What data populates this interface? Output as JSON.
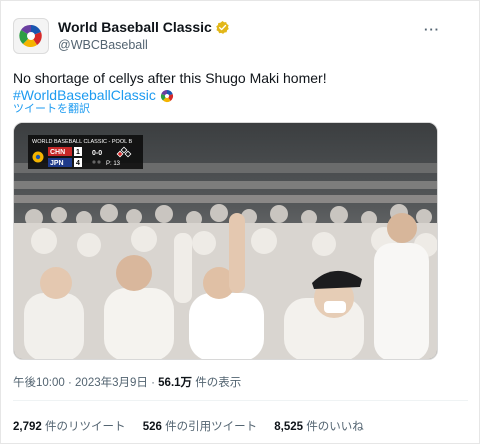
{
  "account": {
    "name": "World Baseball Classic",
    "handle": "@WBCBaseball"
  },
  "menu": {
    "label": "···"
  },
  "tweet": {
    "text": "No shortage of cellys after this Shugo Maki homer!",
    "hashtag": "#WorldBaseballClassic",
    "translate": "ツイートを翻訳"
  },
  "scoreboard": {
    "title": "WORLD BASEBALL CLASSIC - POOL B",
    "teams": [
      {
        "code": "CHN",
        "score": "1"
      },
      {
        "code": "JPN",
        "score": "4"
      }
    ],
    "count": "0-0",
    "pitches": "P: 13"
  },
  "meta": {
    "time": "午後10:00",
    "date": "2023年3月9日",
    "views": "56.1万",
    "views_label": "件の表示"
  },
  "stats": {
    "retweets": "2,792",
    "retweets_label": "件のリツイート",
    "quotes": "526",
    "quotes_label": "件の引用ツイート",
    "likes": "8,525",
    "likes_label": "件のいいね"
  },
  "colors": {
    "accent": "#1d9bf0",
    "verified": "#e2b719",
    "secondary_text": "#536471"
  },
  "icons": {
    "avatar": "wbc-logo-icon",
    "verified": "verified-badge-icon",
    "hashtag_emoji": "wbc-hashflag-icon"
  }
}
